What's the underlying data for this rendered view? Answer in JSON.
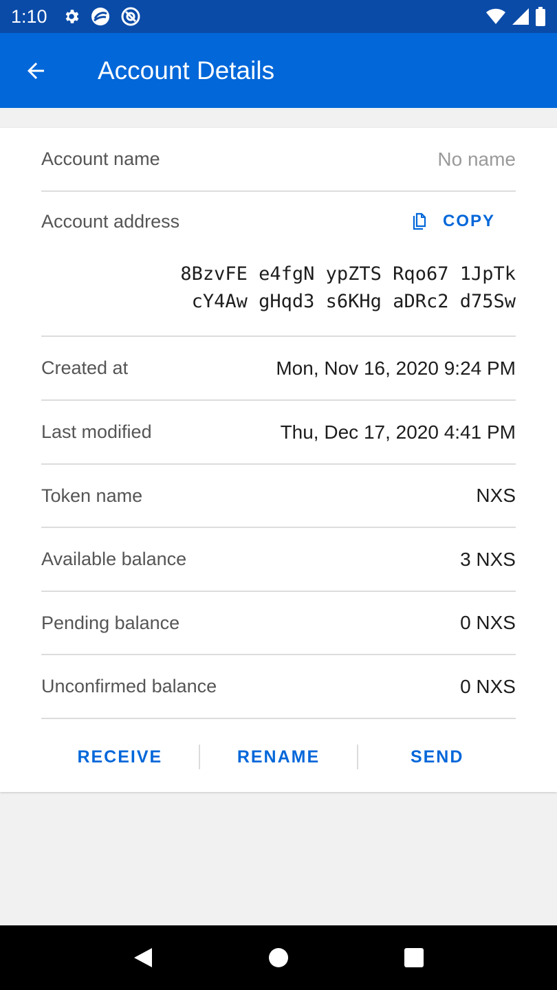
{
  "status_bar": {
    "time": "1:10",
    "left_icons": [
      "gear-icon",
      "sync-app-icon",
      "target-icon"
    ],
    "right_icons": [
      "wifi-icon",
      "signal-icon",
      "battery-icon"
    ]
  },
  "app_bar": {
    "title": "Account Details",
    "back_icon": "arrow-back-icon",
    "color": "#0267d9"
  },
  "details": {
    "account_name": {
      "label": "Account name",
      "value": "No name"
    },
    "account_address": {
      "label": "Account address",
      "copy_label": "COPY",
      "line1": "8BzvFE e4fgN ypZTS Rqo67 1JpTk",
      "line2": "cY4Aw gHqd3 s6KHg aDRc2 d75Sw"
    },
    "created_at": {
      "label": "Created at",
      "value": "Mon, Nov 16, 2020 9:24 PM"
    },
    "last_modified": {
      "label": "Last modified",
      "value": "Thu, Dec 17, 2020 4:41 PM"
    },
    "token_name": {
      "label": "Token name",
      "value": "NXS"
    },
    "available_balance": {
      "label": "Available balance",
      "value": "3 NXS"
    },
    "pending_balance": {
      "label": "Pending balance",
      "value": "0 NXS"
    },
    "unconfirmed_balance": {
      "label": "Unconfirmed balance",
      "value": "0 NXS"
    }
  },
  "actions": {
    "receive": "RECEIVE",
    "rename": "RENAME",
    "send": "SEND"
  },
  "nav_bar": {
    "icons": [
      "back-triangle-icon",
      "home-circle-icon",
      "recents-square-icon"
    ]
  }
}
